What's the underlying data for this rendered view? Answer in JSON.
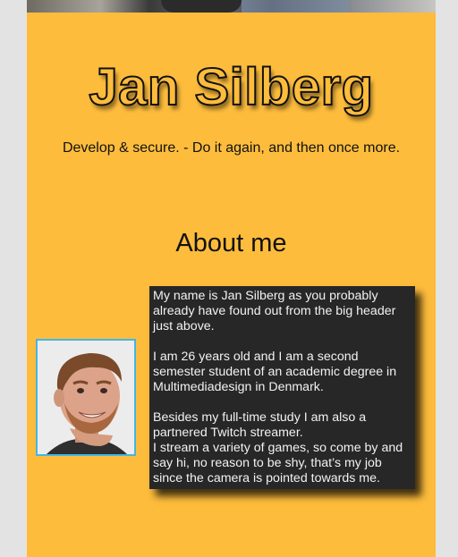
{
  "header": {
    "title": "Jan Silberg",
    "tagline": "Develop & secure. - Do it again, and then once more."
  },
  "about": {
    "heading": "About me",
    "paragraphs": [
      "My name is Jan Silberg as you probably already have found out from the big header just above.",
      "I am 26 years old and I am a second semester student of an academic degree in Multimediadesign in Denmark.",
      "Besides my full-time study I am also a partnered Twitch streamer.",
      "I stream a variety of games, so come by and say hi, no reason to be shy, that’s my job since the camera is pointed towards me."
    ]
  },
  "colors": {
    "page_background": "#fdbc3c",
    "outer_background": "#e3e3e3",
    "bio_box": "#272727",
    "avatar_border": "#43b6e6"
  }
}
